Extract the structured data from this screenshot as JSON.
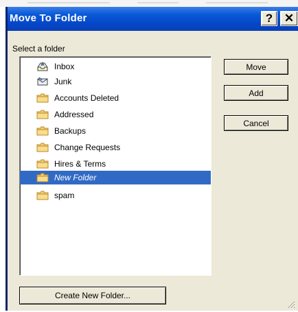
{
  "window": {
    "title": "Move To Folder",
    "help_label": "?",
    "close_label": "✕"
  },
  "select_label": "Select a folder",
  "folders": [
    {
      "name": "Inbox",
      "icon": "inbox-icon"
    },
    {
      "name": "Junk",
      "icon": "junk-icon"
    },
    {
      "name": "Accounts Deleted",
      "icon": "folder-icon"
    },
    {
      "name": "Addressed",
      "icon": "folder-icon"
    },
    {
      "name": "Backups",
      "icon": "folder-icon"
    },
    {
      "name": "Change Requests",
      "icon": "folder-icon"
    },
    {
      "name": "Hires & Terms",
      "icon": "folder-icon"
    },
    {
      "name": "New Folder",
      "icon": "folder-icon",
      "selected": true
    },
    {
      "name": "spam",
      "icon": "folder-icon"
    }
  ],
  "buttons": {
    "move": "Move",
    "add": "Add",
    "cancel": "Cancel",
    "create_new_folder": "Create New Folder..."
  },
  "colors": {
    "titlebar": "#0a5ad8",
    "selection": "#316ac5",
    "dialog_bg": "#ece9d8"
  }
}
